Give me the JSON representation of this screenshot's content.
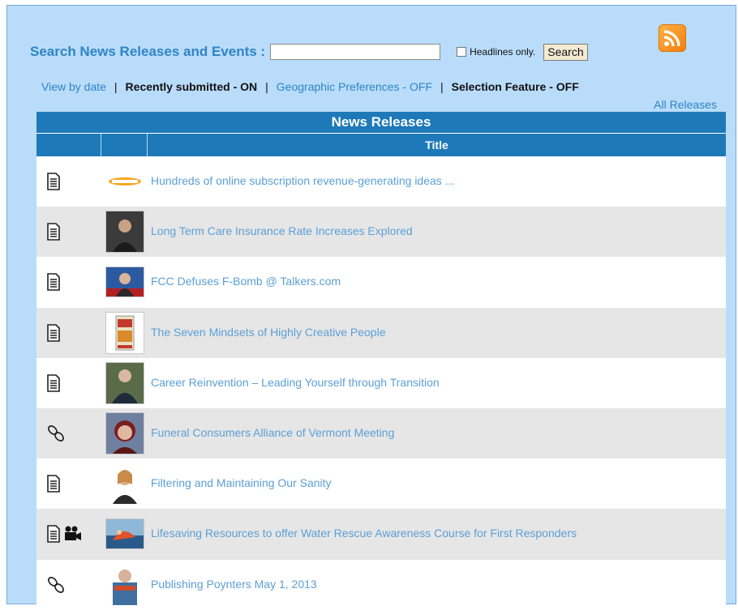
{
  "search": {
    "label": "Search News Releases and Events :",
    "input_value": "",
    "checkbox_label": "Headlines only.",
    "button_label": "Search"
  },
  "nav": {
    "view_by_date": "View by date",
    "recently_submitted": "Recently submitted - ON",
    "geo_prefs": "Geographic Preferences - OFF",
    "selection_feature": "Selection Feature - OFF",
    "separator": "|",
    "all_releases": "All Releases"
  },
  "table": {
    "caption": "News Releases",
    "title_header": "Title",
    "rows": [
      {
        "type": "document",
        "title": "Hundreds of online subscription revenue-generating ideas ..."
      },
      {
        "type": "document",
        "title": "Long Term Care Insurance Rate Increases Explored"
      },
      {
        "type": "document",
        "title": "FCC Defuses F-Bomb @ Talkers.com"
      },
      {
        "type": "document",
        "title": "The Seven Mindsets of Highly Creative People"
      },
      {
        "type": "document",
        "title": "Career Reinvention – Leading Yourself through Transition"
      },
      {
        "type": "link",
        "title": "Funeral Consumers Alliance of Vermont Meeting"
      },
      {
        "type": "document",
        "title": "Filtering and Maintaining Our Sanity"
      },
      {
        "type": "document-video",
        "title": "Lifesaving Resources to offer Water Rescue Awareness Course for First Responders"
      },
      {
        "type": "link",
        "title": "Publishing Poynters May 1, 2013"
      }
    ]
  },
  "colors": {
    "panel_bg": "#b9dcfa",
    "header_blue": "#1e79b8",
    "link_blue": "#2f84c4",
    "row_alt": "#e6e6e6",
    "rss_orange": "#f27d0c"
  }
}
